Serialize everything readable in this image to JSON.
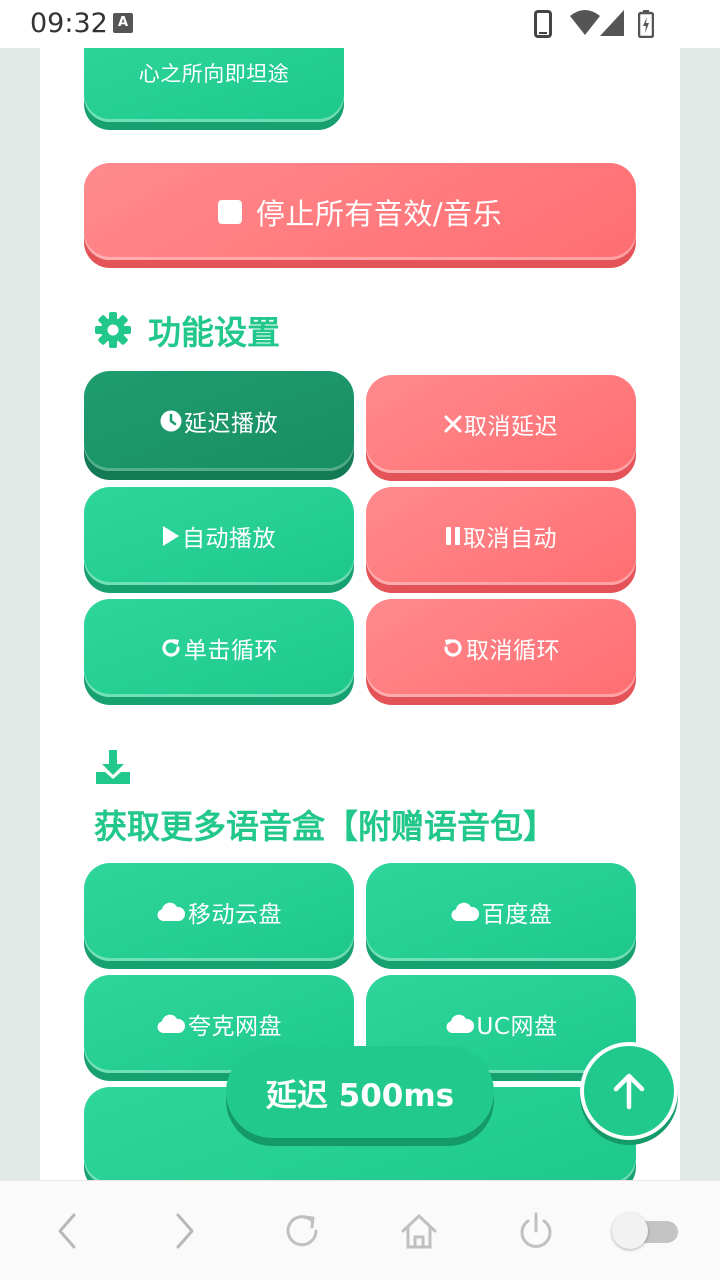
{
  "status_bar": {
    "time": "09:32",
    "badge_letter": "A"
  },
  "top_partial_button": {
    "label": "心之所向即坦途"
  },
  "stop_all_button": {
    "label": "停止所有音效/音乐"
  },
  "settings_section": {
    "title": "功能设置",
    "buttons": [
      {
        "label": "延迟播放",
        "icon": "clock-icon",
        "style": "active"
      },
      {
        "label": "取消延迟",
        "icon": "close-icon",
        "style": "red"
      },
      {
        "label": "自动播放",
        "icon": "play-icon",
        "style": "green"
      },
      {
        "label": "取消自动",
        "icon": "pause-icon",
        "style": "red"
      },
      {
        "label": "单击循环",
        "icon": "redo-icon",
        "style": "green"
      },
      {
        "label": "取消循环",
        "icon": "undo-icon",
        "style": "red"
      }
    ]
  },
  "download_section": {
    "title": "获取更多语音盒【附赠语音包】",
    "buttons": [
      {
        "label": "移动云盘",
        "icon": "cloud-icon"
      },
      {
        "label": "百度盘",
        "icon": "cloud-icon"
      },
      {
        "label": "夸克网盘",
        "icon": "cloud-icon"
      },
      {
        "label": "UC网盘",
        "icon": "cloud-icon"
      }
    ]
  },
  "delay_chip": {
    "label": "延迟 500ms"
  },
  "colors": {
    "green": "#22c98d",
    "green_dark": "#1e9d6f",
    "red": "#ff7a7e",
    "title_green": "#22c78c"
  }
}
